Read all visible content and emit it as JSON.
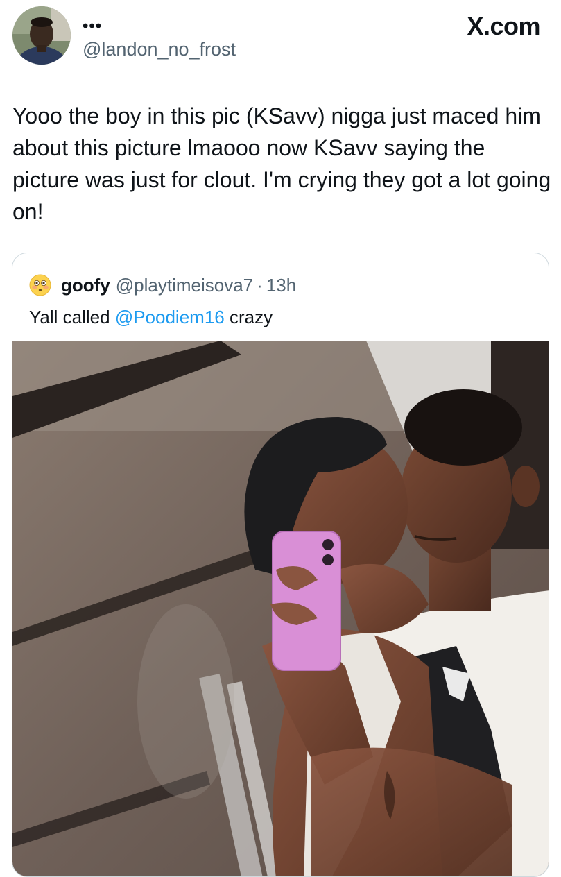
{
  "author": {
    "avatar_icon": "profile-photo",
    "more_icon": "more-dots-icon",
    "more_label": "•••",
    "handle": "@landon_no_frost"
  },
  "brand": {
    "label": "X.com"
  },
  "tweet": {
    "text": "Yooo the boy in this pic (KSavv) nigga just maced him about this picture lmaooo now KSavv saying the picture was just for clout. I'm crying they got a lot going on!"
  },
  "quoted_tweet": {
    "avatar_icon": "flushed-face-emoji",
    "name": "goofy",
    "handle": "@playtimeisova7",
    "separator": "·",
    "time": "13h",
    "text_before": "Yall called ",
    "mention": "@Poodiem16",
    "text_after": " crazy",
    "media": "mirror-selfie-photo"
  },
  "colors": {
    "text": "#0f1419",
    "secondary": "#536471",
    "link": "#1d9bf0",
    "border": "#cfd9de",
    "phone": "#d98fd6"
  }
}
